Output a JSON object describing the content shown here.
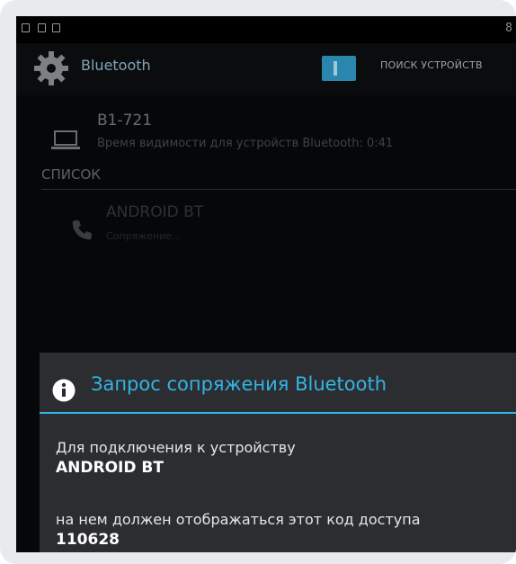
{
  "actionbar": {
    "title": "Bluetooth",
    "toggle_label": "I",
    "action_label": "ПОИСК УСТРОЙСТВ"
  },
  "statusbar": {
    "right_text": "8"
  },
  "device": {
    "name": "B1-721",
    "subtitle": "Время видимости для устройств Bluetooth: 0:41"
  },
  "list": {
    "header": "СПИСОК",
    "items": [
      {
        "name": "ANDROID BT",
        "status": "Сопряжение..."
      }
    ]
  },
  "dialog": {
    "title": "Запрос сопряжения Bluetooth",
    "line1": "Для подключения к устройству",
    "device": "ANDROID BT",
    "line2": "на нем должен отображаться этот код доступа",
    "code": "110628"
  },
  "colors": {
    "accent": "#33b5e5",
    "toggle": "#2a86ad",
    "background": "#060708",
    "dialog": "#2b2d30"
  }
}
